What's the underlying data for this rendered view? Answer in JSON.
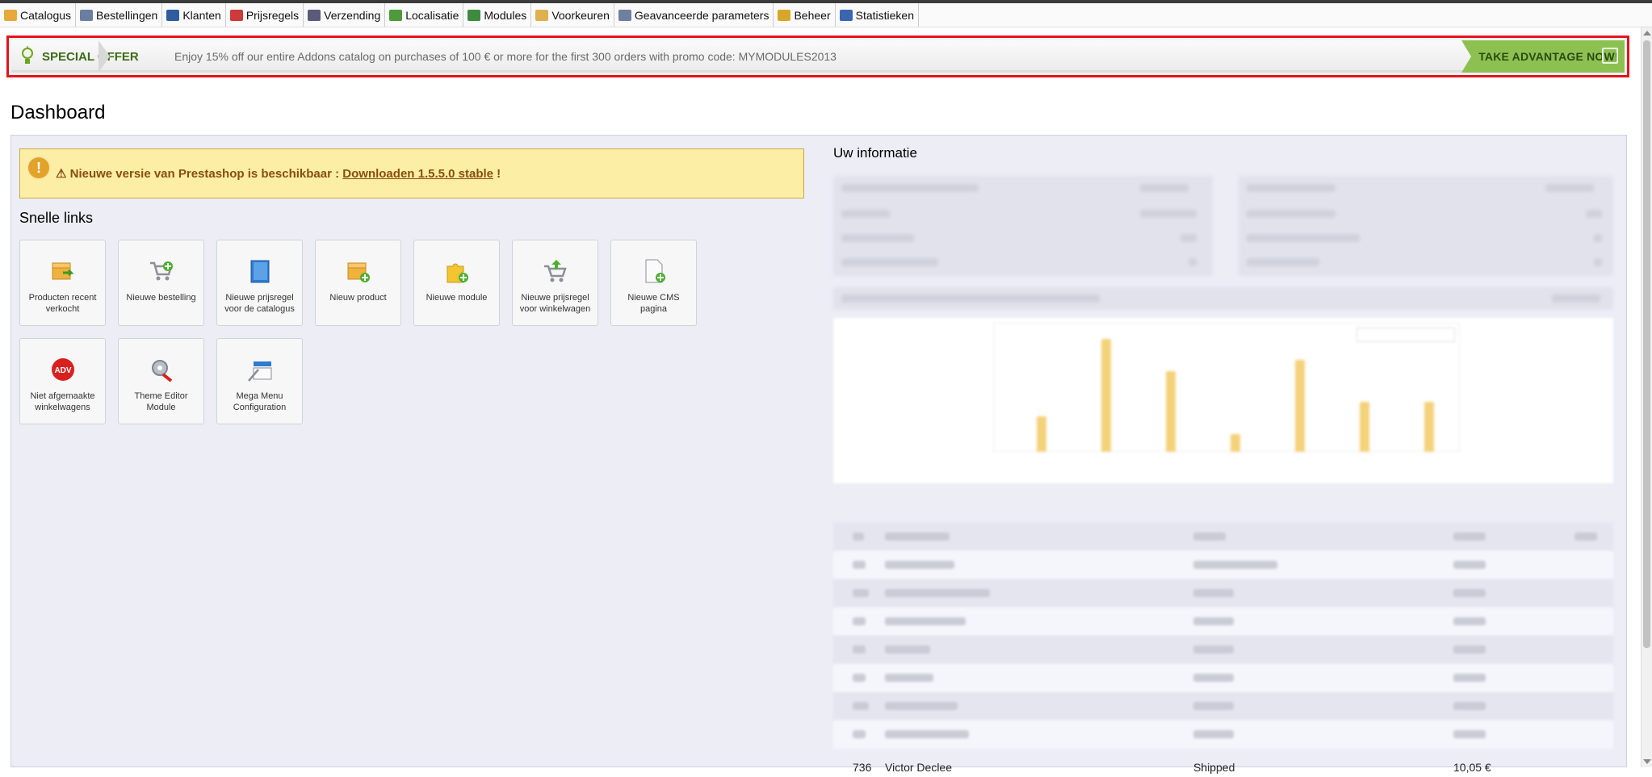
{
  "menu": [
    {
      "label": "Catalogus",
      "icon": "folder-icon",
      "color": "#e6a93a"
    },
    {
      "label": "Bestellingen",
      "icon": "cart-icon",
      "color": "#6a7fa0"
    },
    {
      "label": "Klanten",
      "icon": "user-icon",
      "color": "#2d5d9f"
    },
    {
      "label": "Prijsregels",
      "icon": "price-rule-icon",
      "color": "#cc3a3a"
    },
    {
      "label": "Verzending",
      "icon": "truck-icon",
      "color": "#5a5a7a"
    },
    {
      "label": "Localisatie",
      "icon": "globe-icon",
      "color": "#4e9a3c"
    },
    {
      "label": "Modules",
      "icon": "puzzle-icon",
      "color": "#3d8b3d"
    },
    {
      "label": "Voorkeuren",
      "icon": "preferences-icon",
      "color": "#e0b050"
    },
    {
      "label": "Geavanceerde parameters",
      "icon": "wrench-icon",
      "color": "#6f7f9f"
    },
    {
      "label": "Beheer",
      "icon": "key-icon",
      "color": "#d9a62c"
    },
    {
      "label": "Statistieken",
      "icon": "bar-chart-icon",
      "color": "#3a66b0"
    }
  ],
  "offer": {
    "title": "SPECIAL OFFER",
    "text": "Enjoy 15% off our entire Addons catalog on purchases of 100 € or more for the first 300 orders with promo code: MYMODULES2013",
    "button": "TAKE ADVANTAGE NOW!",
    "accent": "#8cc152",
    "border": "#e5141b"
  },
  "page": {
    "title": "Dashboard"
  },
  "alert": {
    "prefix": "⚠ Nieuwe versie van Prestashop is beschikbaar : ",
    "link": "Downloaden 1.5.5.0 stable",
    "suffix": " !"
  },
  "quicklinks": {
    "title": "Snelle links",
    "items": [
      {
        "label": "Producten recent verkocht",
        "icon": "box-arrow-icon"
      },
      {
        "label": "Nieuwe bestelling",
        "icon": "cart-add-icon"
      },
      {
        "label": "Nieuwe prijsregel voor de catalogus",
        "icon": "book-icon"
      },
      {
        "label": "Nieuw product",
        "icon": "box-add-icon"
      },
      {
        "label": "Nieuwe module",
        "icon": "puzzle-add-icon"
      },
      {
        "label": "Nieuwe prijsregel voor winkelwagen",
        "icon": "cart-rule-icon"
      },
      {
        "label": "Nieuwe CMS pagina",
        "icon": "page-add-icon"
      },
      {
        "label": "Niet afgemaakte winkelwagens",
        "icon": "adv-badge-icon"
      },
      {
        "label": "Theme Editor Module",
        "icon": "gear-brush-icon"
      },
      {
        "label": "Mega Menu Configuration",
        "icon": "menu-config-icon"
      }
    ],
    "adv_text": "ADV"
  },
  "info": {
    "title": "Uw informatie"
  },
  "last_order": {
    "id": "736",
    "customer": "Victor Declee",
    "status": "Shipped",
    "total": "10,05 €"
  }
}
